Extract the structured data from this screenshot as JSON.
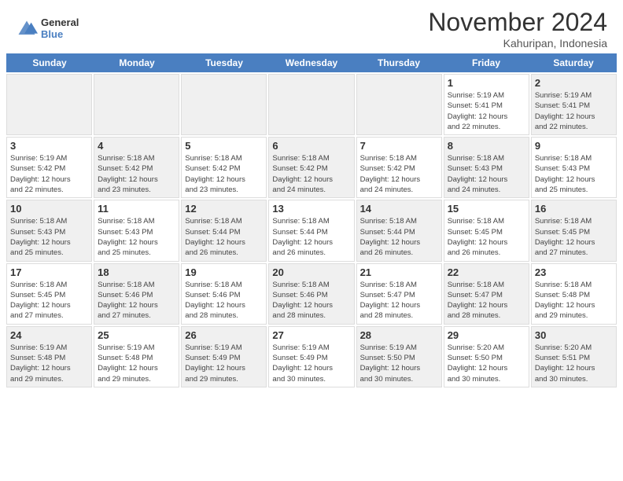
{
  "header": {
    "logo_general": "General",
    "logo_blue": "Blue",
    "title": "November 2024",
    "location": "Kahuripan, Indonesia"
  },
  "calendar": {
    "days_of_week": [
      "Sunday",
      "Monday",
      "Tuesday",
      "Wednesday",
      "Thursday",
      "Friday",
      "Saturday"
    ],
    "rows": [
      [
        {
          "day": "",
          "info": "",
          "shaded": true
        },
        {
          "day": "",
          "info": "",
          "shaded": true
        },
        {
          "day": "",
          "info": "",
          "shaded": true
        },
        {
          "day": "",
          "info": "",
          "shaded": true
        },
        {
          "day": "",
          "info": "",
          "shaded": true
        },
        {
          "day": "1",
          "info": "Sunrise: 5:19 AM\nSunset: 5:41 PM\nDaylight: 12 hours\nand 22 minutes."
        },
        {
          "day": "2",
          "info": "Sunrise: 5:19 AM\nSunset: 5:41 PM\nDaylight: 12 hours\nand 22 minutes.",
          "shaded": true
        }
      ],
      [
        {
          "day": "3",
          "info": "Sunrise: 5:19 AM\nSunset: 5:42 PM\nDaylight: 12 hours\nand 22 minutes."
        },
        {
          "day": "4",
          "info": "Sunrise: 5:18 AM\nSunset: 5:42 PM\nDaylight: 12 hours\nand 23 minutes.",
          "shaded": true
        },
        {
          "day": "5",
          "info": "Sunrise: 5:18 AM\nSunset: 5:42 PM\nDaylight: 12 hours\nand 23 minutes."
        },
        {
          "day": "6",
          "info": "Sunrise: 5:18 AM\nSunset: 5:42 PM\nDaylight: 12 hours\nand 24 minutes.",
          "shaded": true
        },
        {
          "day": "7",
          "info": "Sunrise: 5:18 AM\nSunset: 5:42 PM\nDaylight: 12 hours\nand 24 minutes."
        },
        {
          "day": "8",
          "info": "Sunrise: 5:18 AM\nSunset: 5:43 PM\nDaylight: 12 hours\nand 24 minutes.",
          "shaded": true
        },
        {
          "day": "9",
          "info": "Sunrise: 5:18 AM\nSunset: 5:43 PM\nDaylight: 12 hours\nand 25 minutes."
        }
      ],
      [
        {
          "day": "10",
          "info": "Sunrise: 5:18 AM\nSunset: 5:43 PM\nDaylight: 12 hours\nand 25 minutes.",
          "shaded": true
        },
        {
          "day": "11",
          "info": "Sunrise: 5:18 AM\nSunset: 5:43 PM\nDaylight: 12 hours\nand 25 minutes."
        },
        {
          "day": "12",
          "info": "Sunrise: 5:18 AM\nSunset: 5:44 PM\nDaylight: 12 hours\nand 26 minutes.",
          "shaded": true
        },
        {
          "day": "13",
          "info": "Sunrise: 5:18 AM\nSunset: 5:44 PM\nDaylight: 12 hours\nand 26 minutes."
        },
        {
          "day": "14",
          "info": "Sunrise: 5:18 AM\nSunset: 5:44 PM\nDaylight: 12 hours\nand 26 minutes.",
          "shaded": true
        },
        {
          "day": "15",
          "info": "Sunrise: 5:18 AM\nSunset: 5:45 PM\nDaylight: 12 hours\nand 26 minutes."
        },
        {
          "day": "16",
          "info": "Sunrise: 5:18 AM\nSunset: 5:45 PM\nDaylight: 12 hours\nand 27 minutes.",
          "shaded": true
        }
      ],
      [
        {
          "day": "17",
          "info": "Sunrise: 5:18 AM\nSunset: 5:45 PM\nDaylight: 12 hours\nand 27 minutes."
        },
        {
          "day": "18",
          "info": "Sunrise: 5:18 AM\nSunset: 5:46 PM\nDaylight: 12 hours\nand 27 minutes.",
          "shaded": true
        },
        {
          "day": "19",
          "info": "Sunrise: 5:18 AM\nSunset: 5:46 PM\nDaylight: 12 hours\nand 28 minutes."
        },
        {
          "day": "20",
          "info": "Sunrise: 5:18 AM\nSunset: 5:46 PM\nDaylight: 12 hours\nand 28 minutes.",
          "shaded": true
        },
        {
          "day": "21",
          "info": "Sunrise: 5:18 AM\nSunset: 5:47 PM\nDaylight: 12 hours\nand 28 minutes."
        },
        {
          "day": "22",
          "info": "Sunrise: 5:18 AM\nSunset: 5:47 PM\nDaylight: 12 hours\nand 28 minutes.",
          "shaded": true
        },
        {
          "day": "23",
          "info": "Sunrise: 5:18 AM\nSunset: 5:48 PM\nDaylight: 12 hours\nand 29 minutes."
        }
      ],
      [
        {
          "day": "24",
          "info": "Sunrise: 5:19 AM\nSunset: 5:48 PM\nDaylight: 12 hours\nand 29 minutes.",
          "shaded": true
        },
        {
          "day": "25",
          "info": "Sunrise: 5:19 AM\nSunset: 5:48 PM\nDaylight: 12 hours\nand 29 minutes."
        },
        {
          "day": "26",
          "info": "Sunrise: 5:19 AM\nSunset: 5:49 PM\nDaylight: 12 hours\nand 29 minutes.",
          "shaded": true
        },
        {
          "day": "27",
          "info": "Sunrise: 5:19 AM\nSunset: 5:49 PM\nDaylight: 12 hours\nand 30 minutes."
        },
        {
          "day": "28",
          "info": "Sunrise: 5:19 AM\nSunset: 5:50 PM\nDaylight: 12 hours\nand 30 minutes.",
          "shaded": true
        },
        {
          "day": "29",
          "info": "Sunrise: 5:20 AM\nSunset: 5:50 PM\nDaylight: 12 hours\nand 30 minutes."
        },
        {
          "day": "30",
          "info": "Sunrise: 5:20 AM\nSunset: 5:51 PM\nDaylight: 12 hours\nand 30 minutes.",
          "shaded": true
        }
      ]
    ]
  }
}
